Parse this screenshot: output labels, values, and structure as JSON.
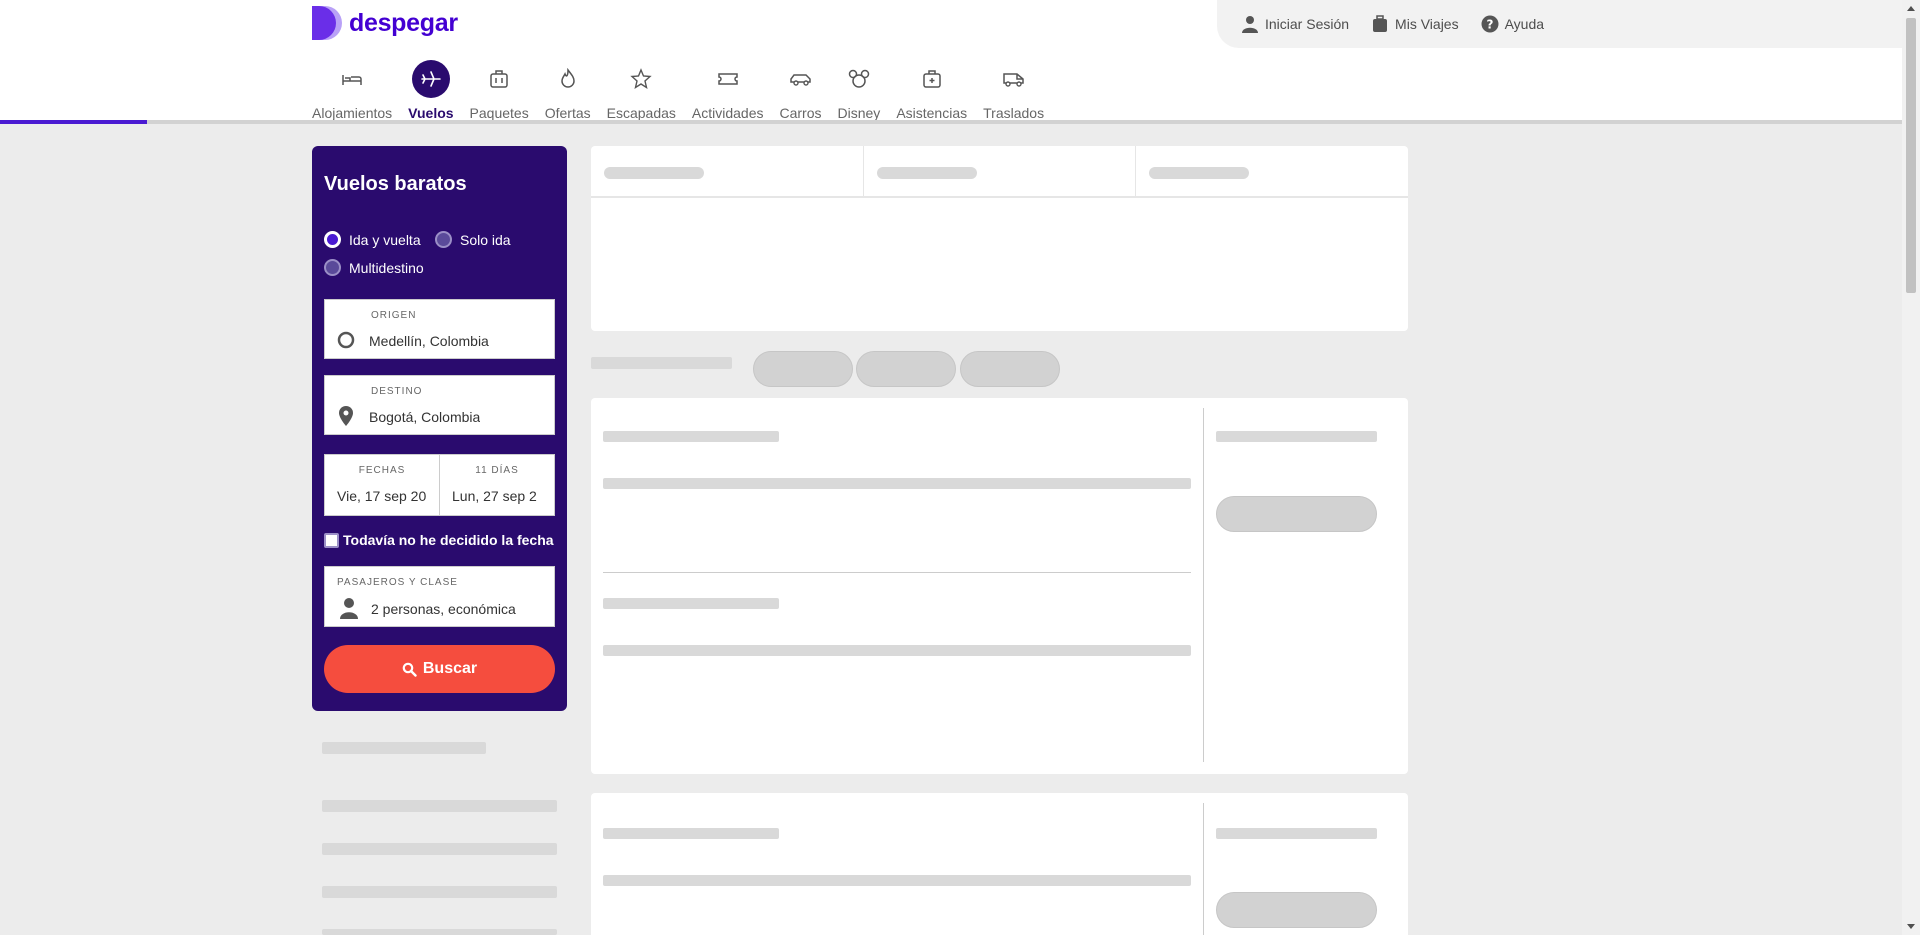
{
  "brand": {
    "name": "despegar",
    "color": "#4300d2"
  },
  "topbar": {
    "login": {
      "label": "Iniciar Sesión",
      "icon": "user-icon"
    },
    "trips": {
      "label": "Mis Viajes",
      "icon": "suitcase-icon"
    },
    "help": {
      "label": "Ayuda",
      "icon": "help-icon"
    }
  },
  "nav": {
    "items": [
      {
        "label": "Alojamientos",
        "icon": "bed-icon",
        "active": false
      },
      {
        "label": "Vuelos",
        "icon": "plane-icon",
        "active": true
      },
      {
        "label": "Paquetes",
        "icon": "luggage-icon",
        "active": false
      },
      {
        "label": "Ofertas",
        "icon": "flame-icon",
        "active": false
      },
      {
        "label": "Escapadas",
        "icon": "star-icon",
        "active": false
      },
      {
        "label": "Actividades",
        "icon": "ticket-icon",
        "active": false
      },
      {
        "label": "Carros",
        "icon": "car-icon",
        "active": false
      },
      {
        "label": "Disney",
        "icon": "disney-icon",
        "active": false
      },
      {
        "label": "Asistencias",
        "icon": "medical-kit-icon",
        "active": false
      },
      {
        "label": "Traslados",
        "icon": "shuttle-icon",
        "active": false
      }
    ]
  },
  "search": {
    "title": "Vuelos baratos",
    "trip_types": [
      "Ida y vuelta",
      "Solo ida",
      "Multidestino"
    ],
    "selected_trip_type": "Ida y vuelta",
    "origin": {
      "label": "ORIGEN",
      "value": "Medellín, Colombia"
    },
    "destination": {
      "label": "DESTINO",
      "value": "Bogotá, Colombia"
    },
    "dates": {
      "depart_label": "FECHAS",
      "depart_value": "Vie, 17 sep 20",
      "return_label": "11 DÍAS",
      "return_value": "Lun, 27 sep 2"
    },
    "undecided_label": "Todavía no he decidido la fecha",
    "passengers": {
      "label": "PASAJEROS Y CLASE",
      "value": "2 personas, económica"
    },
    "button_label": "Buscar"
  },
  "colors": {
    "panel": "#2a0b6e",
    "accent": "#4a1ad2",
    "cta": "#f54d3e",
    "skeleton": "#d9d9d9"
  }
}
